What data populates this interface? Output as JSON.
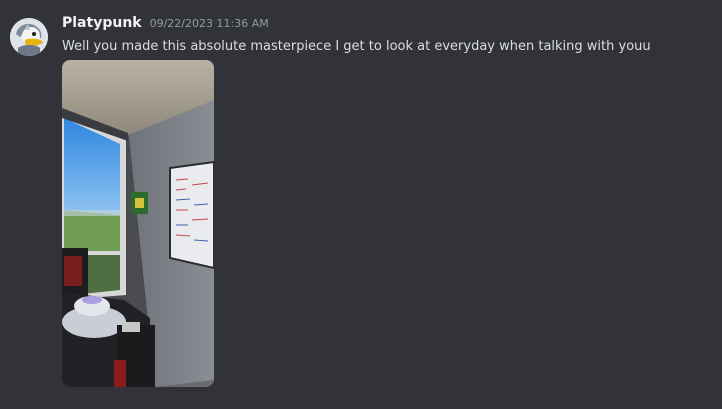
{
  "message": {
    "author": "Platypunk",
    "timestamp": "09/22/2023 11:36 AM",
    "content": "Well you made this absolute masterpiece I get to look at everyday when talking with youu"
  },
  "attachment": {
    "kind": "image",
    "icon": "photo-icon"
  },
  "avatar": {
    "icon": "platypus-avatar-icon"
  },
  "colors": {
    "background": "#313338",
    "username": "#f2f3f5",
    "text": "#dbdee1",
    "timestamp": "#949ba4"
  }
}
